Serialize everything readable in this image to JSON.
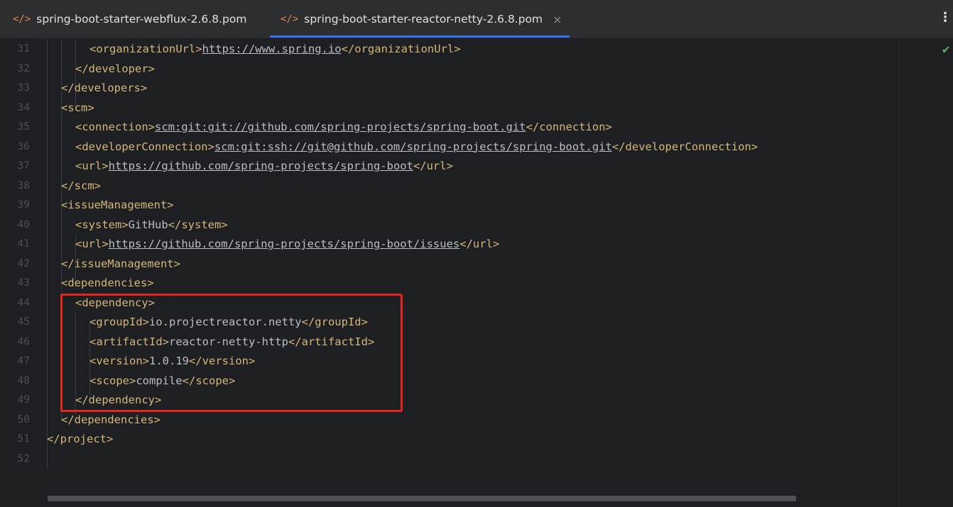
{
  "tabs": [
    {
      "label": "spring-boot-starter-webflux-2.6.8.pom",
      "icon": "xml-file-icon",
      "active": false
    },
    {
      "label": "spring-boot-starter-reactor-netty-2.6.8.pom",
      "icon": "xml-file-icon",
      "active": true
    }
  ],
  "glyphs": {
    "file_icon": "</>",
    "close": "×",
    "more": "⋮",
    "check": "✔"
  },
  "colors": {
    "tag": "#d5b778",
    "text": "#bcbec4",
    "line_number": "#4b5059",
    "active_tab_underline": "#3574f0",
    "highlight_box": "#e5261e",
    "check": "#5fb865"
  },
  "editor": {
    "lines": [
      {
        "num": "31",
        "parts": [
          [
            "t",
            "<organizationUrl>"
          ],
          [
            "u",
            "https://www.spring.io"
          ],
          [
            "t",
            "</organizationUrl>"
          ]
        ]
      },
      {
        "num": "32",
        "parts": [
          [
            "t",
            "</developer>"
          ]
        ]
      },
      {
        "num": "33",
        "parts": [
          [
            "t",
            "</developers>"
          ]
        ]
      },
      {
        "num": "34",
        "parts": [
          [
            "t",
            "<scm>"
          ]
        ]
      },
      {
        "num": "35",
        "parts": [
          [
            "t",
            "<connection>"
          ],
          [
            "u",
            "scm:git:git://github.com/spring-projects/spring-boot.git"
          ],
          [
            "t",
            "</connection>"
          ]
        ]
      },
      {
        "num": "36",
        "parts": [
          [
            "t",
            "<developerConnection>"
          ],
          [
            "u",
            "scm:git:ssh://git@github.com/spring-projects/spring-boot.git"
          ],
          [
            "t",
            "</developerConnection>"
          ]
        ]
      },
      {
        "num": "37",
        "parts": [
          [
            "t",
            "<url>"
          ],
          [
            "u",
            "https://github.com/spring-projects/spring-boot"
          ],
          [
            "t",
            "</url>"
          ]
        ]
      },
      {
        "num": "38",
        "parts": [
          [
            "t",
            "</scm>"
          ]
        ]
      },
      {
        "num": "39",
        "parts": [
          [
            "t",
            "<issueManagement>"
          ]
        ]
      },
      {
        "num": "40",
        "parts": [
          [
            "t",
            "<system>"
          ],
          [
            "x",
            "GitHub"
          ],
          [
            "t",
            "</system>"
          ]
        ]
      },
      {
        "num": "41",
        "parts": [
          [
            "t",
            "<url>"
          ],
          [
            "u",
            "https://github.com/spring-projects/spring-boot/issues"
          ],
          [
            "t",
            "</url>"
          ]
        ]
      },
      {
        "num": "42",
        "parts": [
          [
            "t",
            "</issueManagement>"
          ]
        ]
      },
      {
        "num": "43",
        "parts": [
          [
            "t",
            "<dependencies>"
          ]
        ]
      },
      {
        "num": "44",
        "parts": [
          [
            "t",
            "<dependency>"
          ]
        ]
      },
      {
        "num": "45",
        "parts": [
          [
            "t",
            "<groupId>"
          ],
          [
            "x",
            "io.projectreactor.netty"
          ],
          [
            "t",
            "</groupId>"
          ]
        ]
      },
      {
        "num": "46",
        "parts": [
          [
            "t",
            "<artifactId>"
          ],
          [
            "x",
            "reactor-netty-http"
          ],
          [
            "t",
            "</artifactId>"
          ]
        ]
      },
      {
        "num": "47",
        "parts": [
          [
            "t",
            "<version>"
          ],
          [
            "x",
            "1.0.19"
          ],
          [
            "t",
            "</version>"
          ]
        ]
      },
      {
        "num": "48",
        "parts": [
          [
            "t",
            "<scope>"
          ],
          [
            "x",
            "compile"
          ],
          [
            "t",
            "</scope>"
          ]
        ]
      },
      {
        "num": "49",
        "parts": [
          [
            "t",
            "</dependency>"
          ]
        ]
      },
      {
        "num": "50",
        "parts": [
          [
            "t",
            "</dependencies>"
          ]
        ]
      },
      {
        "num": "51",
        "parts": [
          [
            "t",
            "</project>"
          ]
        ]
      },
      {
        "num": "52",
        "parts": []
      }
    ]
  }
}
